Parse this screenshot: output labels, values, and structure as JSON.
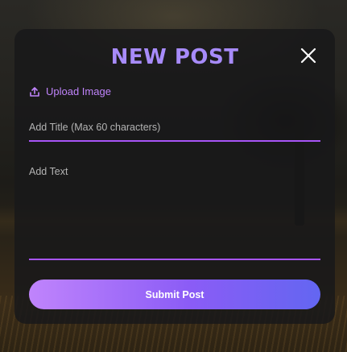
{
  "modal": {
    "title": "NEW POST",
    "upload_label": "Upload Image",
    "title_input": {
      "placeholder": "Add Title (Max 60 characters)",
      "value": ""
    },
    "text_input": {
      "placeholder": "Add Text",
      "value": ""
    },
    "submit_label": "Submit Post"
  },
  "icons": {
    "close": "close-icon",
    "upload": "upload-icon"
  },
  "colors": {
    "accent": "#a78bfa",
    "underline": "#a855f7",
    "button_gradient_start": "#c084fc",
    "button_gradient_end": "#6366f1"
  }
}
